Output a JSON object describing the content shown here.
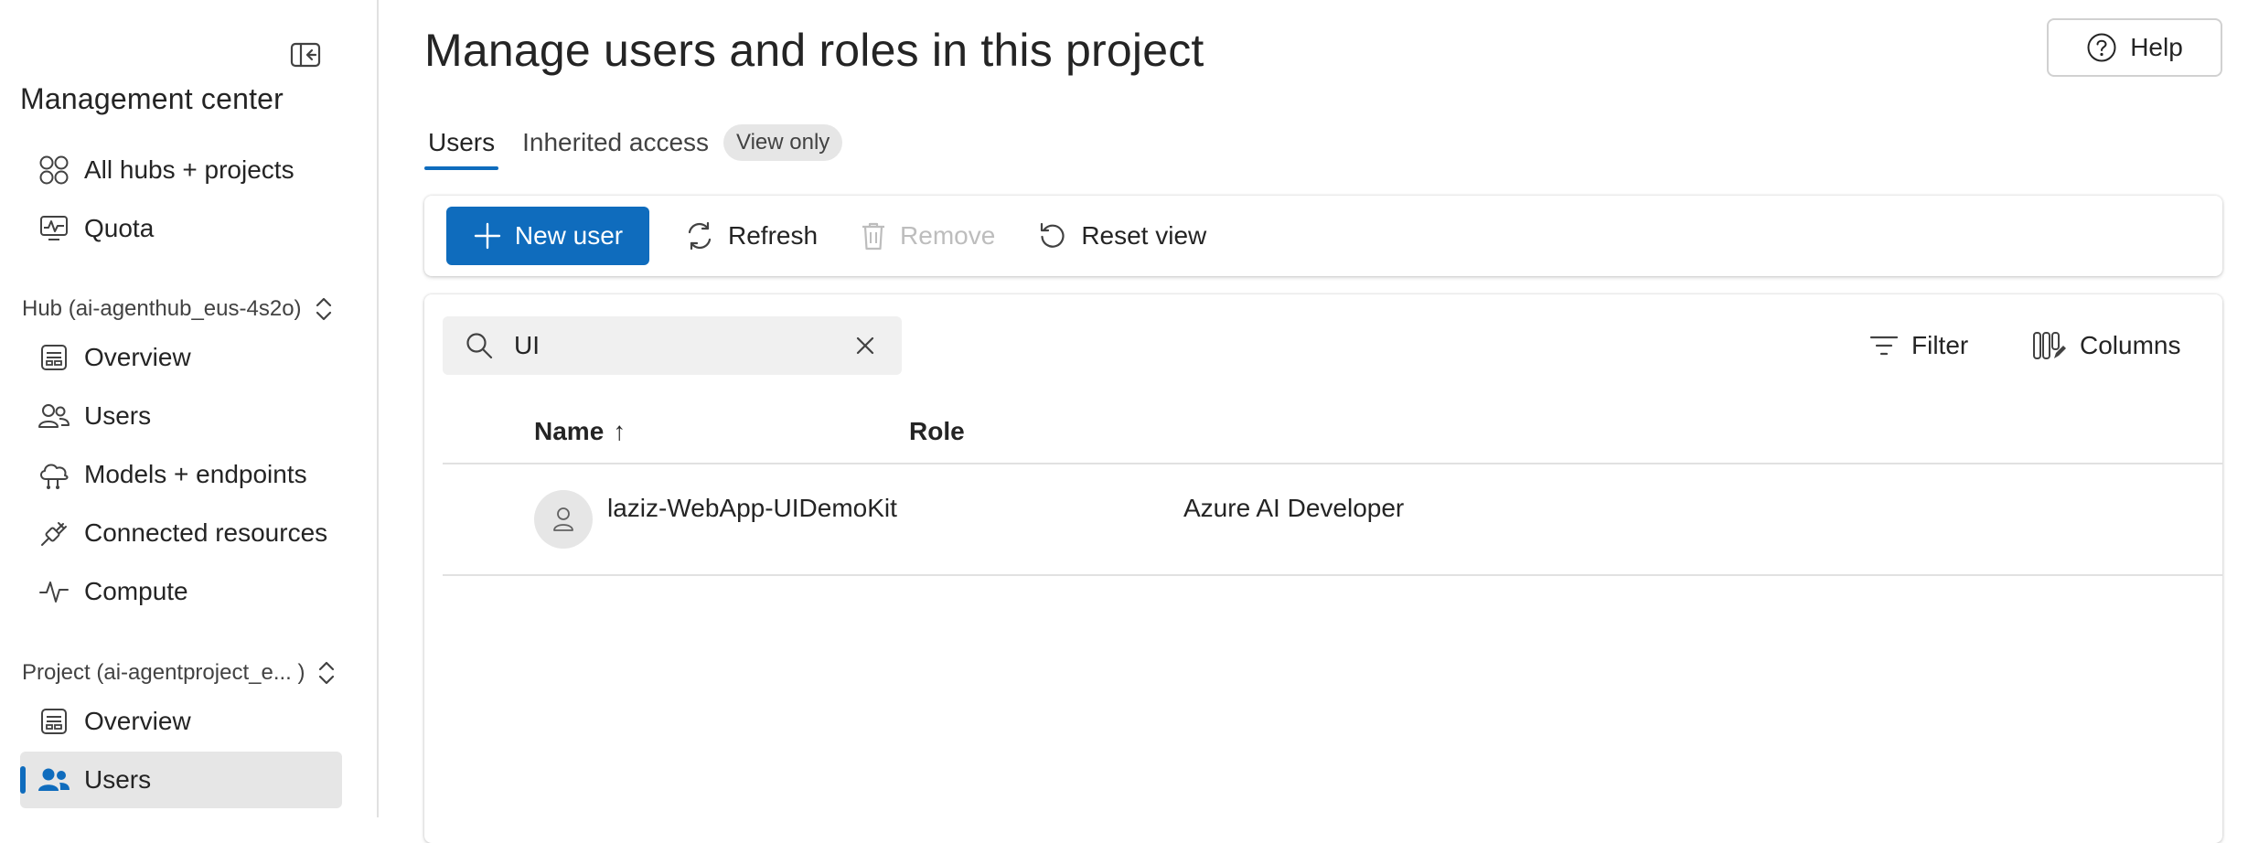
{
  "sidebar": {
    "title": "Management center",
    "top_items": [
      {
        "label": "All hubs + projects",
        "icon": "grid-icon"
      },
      {
        "label": "Quota",
        "icon": "quota-icon"
      }
    ],
    "hub_section": {
      "title": "Hub (ai-agenthub_eus-4s2o)",
      "items": [
        {
          "label": "Overview",
          "icon": "overview-icon"
        },
        {
          "label": "Users",
          "icon": "users-icon"
        },
        {
          "label": "Models + endpoints",
          "icon": "cloud-icon"
        },
        {
          "label": "Connected resources",
          "icon": "plug-icon"
        },
        {
          "label": "Compute",
          "icon": "pulse-icon"
        }
      ]
    },
    "project_section": {
      "title": "Project (ai-agentproject_e... )",
      "items": [
        {
          "label": "Overview",
          "icon": "overview-icon"
        },
        {
          "label": "Users",
          "icon": "users-icon",
          "selected": true
        }
      ]
    }
  },
  "header": {
    "title": "Manage users and roles in this project",
    "help_label": "Help"
  },
  "tabs": [
    {
      "label": "Users",
      "active": true
    },
    {
      "label": "Inherited access",
      "badge": "View only"
    }
  ],
  "toolbar": {
    "new_user_label": "New user",
    "refresh_label": "Refresh",
    "remove_label": "Remove",
    "reset_view_label": "Reset view"
  },
  "search": {
    "value": "UI"
  },
  "list_actions": {
    "filter_label": "Filter",
    "columns_label": "Columns"
  },
  "table": {
    "columns": [
      {
        "label": "Name",
        "sort": "↑"
      },
      {
        "label": "Role"
      }
    ],
    "rows": [
      {
        "name": "laziz-WebApp-UIDemoKit",
        "role": "Azure AI Developer"
      }
    ]
  },
  "colors": {
    "accent": "#0f6cbd",
    "selected_bg": "#e6e6e6",
    "badge_bg": "#e6e6e6"
  }
}
